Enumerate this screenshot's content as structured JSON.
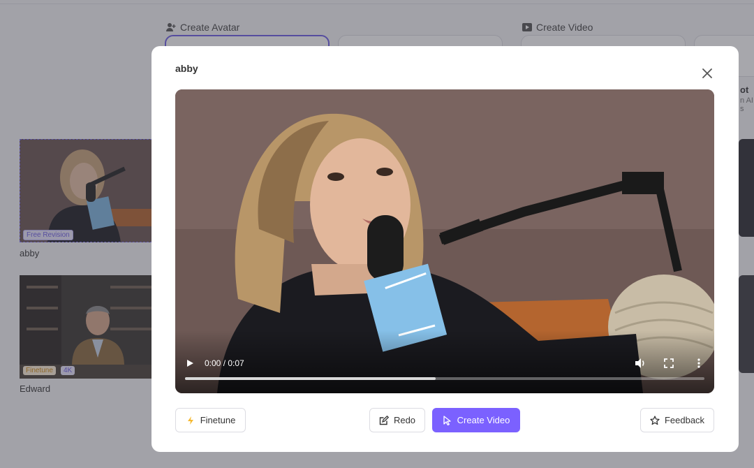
{
  "background": {
    "sections": {
      "create_avatar": "Create Avatar",
      "create_video": "Create Video"
    },
    "side_card": {
      "title_fragment": "ot",
      "sub_fragment": "n AI s"
    },
    "avatars": [
      {
        "name": "abby",
        "badges": [
          "Free Revision"
        ]
      },
      {
        "name": "Edward",
        "badges": [
          "Finetune",
          "4K"
        ]
      }
    ]
  },
  "modal": {
    "title": "abby",
    "video": {
      "time_display": "0:00 / 0:07",
      "progress_buffered": 0.482
    },
    "buttons": {
      "finetune": "Finetune",
      "redo": "Redo",
      "create_video": "Create Video",
      "feedback": "Feedback"
    }
  },
  "icons": {
    "close": "close-icon",
    "play": "play-icon",
    "volume": "volume-icon",
    "fullscreen": "fullscreen-icon",
    "more": "more-vertical-icon",
    "finetune": "lightning-icon",
    "redo": "edit-icon",
    "create_video": "cursor-icon",
    "feedback": "star-icon"
  },
  "colors": {
    "primary": "#7b61ff",
    "accent_badge": "#6c5ce7",
    "finetune_badge": "#d18a12"
  }
}
